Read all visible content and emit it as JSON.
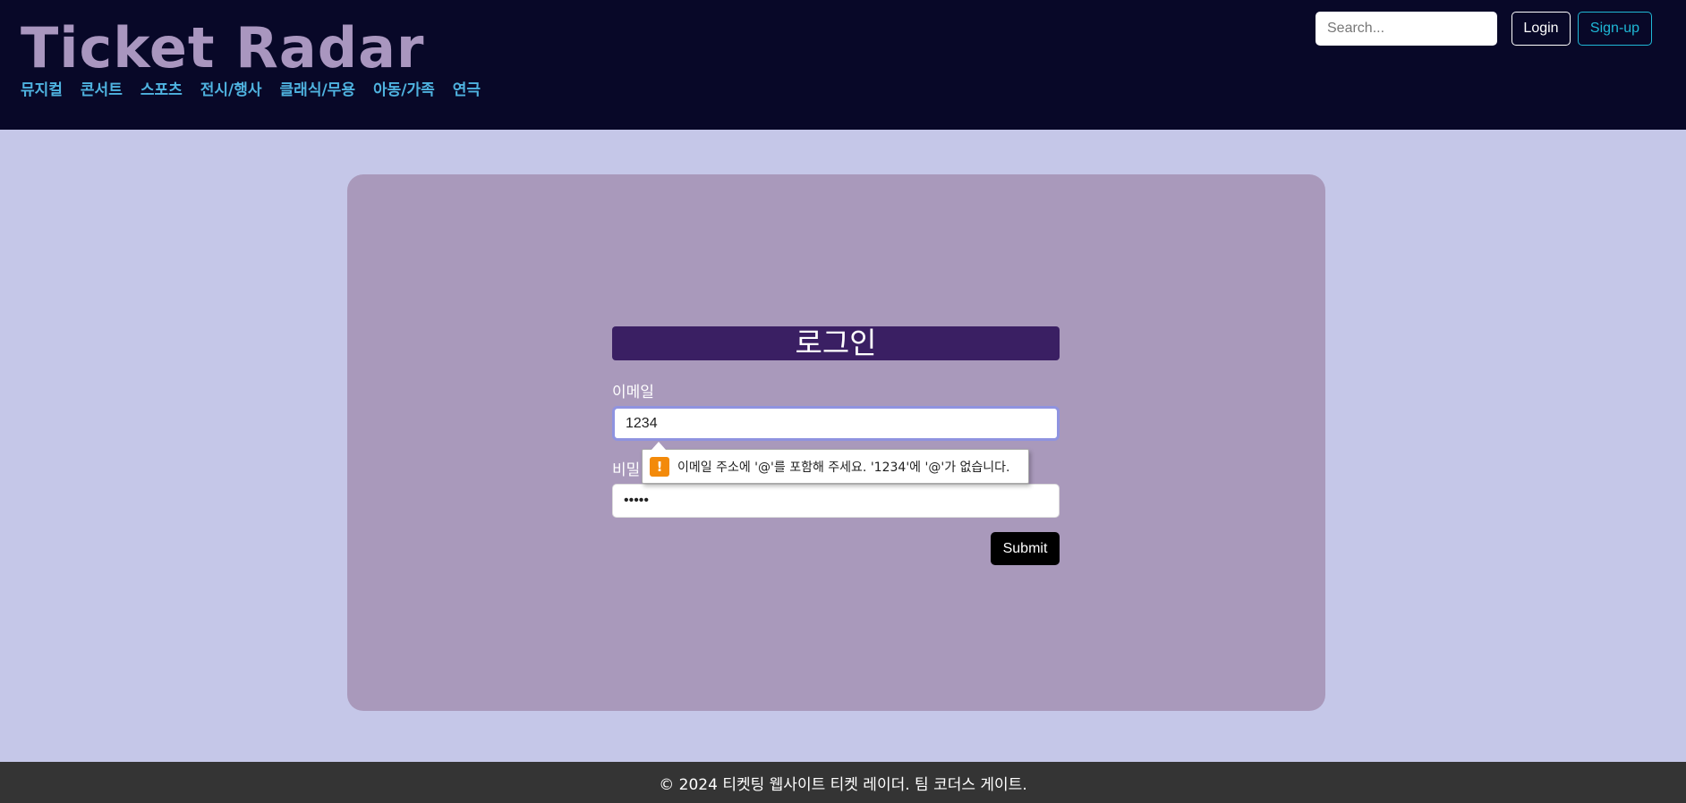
{
  "header": {
    "logo": "Ticket Radar",
    "nav": [
      "뮤지컬",
      "콘서트",
      "스포츠",
      "전시/행사",
      "클래식/무용",
      "아동/가족",
      "연극"
    ],
    "search_placeholder": "Search...",
    "login_label": "Login",
    "signup_label": "Sign-up"
  },
  "form": {
    "title": "로그인",
    "email_label": "이메일",
    "email_value": "1234",
    "password_label": "비밀",
    "password_value": "12345",
    "submit_label": "Submit"
  },
  "validation": {
    "icon": "warning-icon",
    "message": "이메일 주소에 '@'를 포함해 주세요. '1234'에 '@'가 없습니다."
  },
  "footer": {
    "text": "© 2024 티켓팅 웹사이트 티켓 레이더. 팀 코더스 게이트."
  },
  "colors": {
    "header_bg": "#080828",
    "page_bg": "#c5c7e8",
    "card_bg": "#a999bb",
    "title_bg": "#3a1f63",
    "nav_link": "#4fb3e0",
    "logo": "#a996bf",
    "signup_accent": "#1fb8d6",
    "warning": "#f38a0a",
    "footer_bg": "#343434"
  }
}
